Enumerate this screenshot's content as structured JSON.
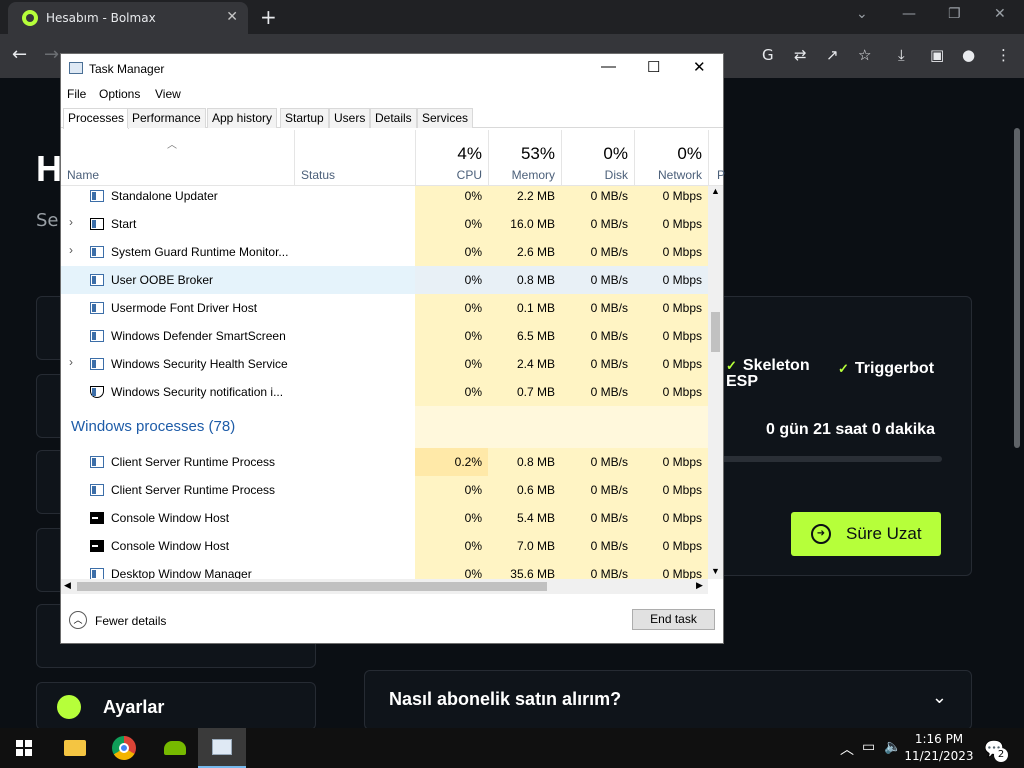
{
  "browser": {
    "tab_title": "Hesabım - Bolmax",
    "tab_close": "✕",
    "new_tab": "+",
    "window_controls": [
      "⌄",
      "—",
      "❐",
      "✕"
    ],
    "nav": {
      "back": "←",
      "forward": "→"
    }
  },
  "page": {
    "heading_partial": "H",
    "sub_partial": "Se",
    "features": [
      "Skeleton ESP",
      "Triggerbot"
    ],
    "time_left": "0 gün 21 saat 0 dakika",
    "extend_button": "Süre Uzat",
    "faq_question": "Nasıl abonelik satın alırım?",
    "settings_label": "Ayarlar"
  },
  "task_manager": {
    "title": "Task Manager",
    "window_controls": [
      "—",
      "☐",
      "✕"
    ],
    "menu": [
      "File",
      "Options",
      "View"
    ],
    "tabs": [
      "Processes",
      "Performance",
      "App history",
      "Startup",
      "Users",
      "Details",
      "Services"
    ],
    "active_tab": "Processes",
    "columns": {
      "name": "Name",
      "status": "Status",
      "cpu": {
        "pct": "4%",
        "label": "CPU"
      },
      "memory": {
        "pct": "53%",
        "label": "Memory"
      },
      "disk": {
        "pct": "0%",
        "label": "Disk"
      },
      "network": {
        "pct": "0%",
        "label": "Network"
      },
      "next": "P"
    },
    "rows": [
      {
        "name": "Standalone Updater",
        "cpu": "0%",
        "mem": "2.2 MB",
        "disk": "0 MB/s",
        "net": "0 Mbps",
        "expand": "",
        "icon": "app"
      },
      {
        "name": "Start",
        "cpu": "0%",
        "mem": "16.0 MB",
        "disk": "0 MB/s",
        "net": "0 Mbps",
        "expand": "›",
        "icon": "start"
      },
      {
        "name": "System Guard Runtime Monitor...",
        "cpu": "0%",
        "mem": "2.6 MB",
        "disk": "0 MB/s",
        "net": "0 Mbps",
        "expand": "›",
        "icon": "app"
      },
      {
        "name": "User OOBE Broker",
        "cpu": "0%",
        "mem": "0.8 MB",
        "disk": "0 MB/s",
        "net": "0 Mbps",
        "expand": "",
        "icon": "app"
      },
      {
        "name": "Usermode Font Driver Host",
        "cpu": "0%",
        "mem": "0.1 MB",
        "disk": "0 MB/s",
        "net": "0 Mbps",
        "expand": "",
        "icon": "app"
      },
      {
        "name": "Windows Defender SmartScreen",
        "cpu": "0%",
        "mem": "6.5 MB",
        "disk": "0 MB/s",
        "net": "0 Mbps",
        "expand": "",
        "icon": "app"
      },
      {
        "name": "Windows Security Health Service",
        "cpu": "0%",
        "mem": "2.4 MB",
        "disk": "0 MB/s",
        "net": "0 Mbps",
        "expand": "›",
        "icon": "app"
      },
      {
        "name": "Windows Security notification i...",
        "cpu": "0%",
        "mem": "0.7 MB",
        "disk": "0 MB/s",
        "net": "0 Mbps",
        "expand": "",
        "icon": "shield"
      }
    ],
    "group_title": "Windows processes (78)",
    "group_rows": [
      {
        "name": "Client Server Runtime Process",
        "cpu": "0.2%",
        "mem": "0.8 MB",
        "disk": "0 MB/s",
        "net": "0 Mbps",
        "icon": "app"
      },
      {
        "name": "Client Server Runtime Process",
        "cpu": "0%",
        "mem": "0.6 MB",
        "disk": "0 MB/s",
        "net": "0 Mbps",
        "icon": "app"
      },
      {
        "name": "Console Window Host",
        "cpu": "0%",
        "mem": "5.4 MB",
        "disk": "0 MB/s",
        "net": "0 Mbps",
        "icon": "console"
      },
      {
        "name": "Console Window Host",
        "cpu": "0%",
        "mem": "7.0 MB",
        "disk": "0 MB/s",
        "net": "0 Mbps",
        "icon": "console"
      },
      {
        "name": "Desktop Window Manager",
        "cpu": "0%",
        "mem": "35.6 MB",
        "disk": "0 MB/s",
        "net": "0 Mbps",
        "icon": "app"
      }
    ],
    "fewer_details": "Fewer details",
    "end_task": "End task"
  },
  "taskbar": {
    "time": "1:16 PM",
    "date": "11/21/2023",
    "notification_count": "2"
  },
  "colors": {
    "accent": "#b6ff3a",
    "tm_heat": "#fff4c4",
    "group_title": "#1e5ca8"
  }
}
